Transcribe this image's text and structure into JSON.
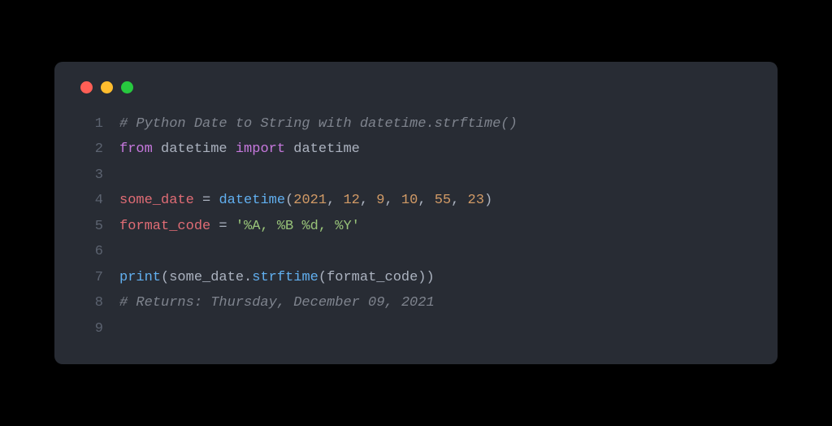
{
  "traffic_lights": {
    "red": "#ff5f56",
    "yellow": "#ffbd2e",
    "green": "#27c93f"
  },
  "line_numbers": [
    "1",
    "2",
    "3",
    "4",
    "5",
    "6",
    "7",
    "8",
    "9"
  ],
  "code": {
    "l1": {
      "comment": "# Python Date to String with datetime.strftime()"
    },
    "l2": {
      "kw_from": "from",
      "module1": "datetime",
      "kw_import": "import",
      "module2": "datetime"
    },
    "l4": {
      "var": "some_date",
      "eq": " = ",
      "func": "datetime",
      "open": "(",
      "n1": "2021",
      "c1": ", ",
      "n2": "12",
      "c2": ", ",
      "n3": "9",
      "c3": ", ",
      "n4": "10",
      "c4": ", ",
      "n5": "55",
      "c5": ", ",
      "n6": "23",
      "close": ")"
    },
    "l5": {
      "var": "format_code",
      "eq": " = ",
      "str": "'%A, %B %d, %Y'"
    },
    "l7": {
      "builtin": "print",
      "open1": "(",
      "arg1": "some_date",
      "dot": ".",
      "method": "strftime",
      "open2": "(",
      "arg2": "format_code",
      "close2": ")",
      "close1": ")"
    },
    "l8": {
      "comment": "# Returns: Thursday, December 09, 2021"
    }
  },
  "chart_data": {
    "type": "table",
    "title": "Python Date to String with datetime.strftime()",
    "language": "python",
    "source_lines": [
      "# Python Date to String with datetime.strftime()",
      "from datetime import datetime",
      "",
      "some_date = datetime(2021, 12, 9, 10, 55, 23)",
      "format_code = '%A, %B %d, %Y'",
      "",
      "print(some_date.strftime(format_code))",
      "# Returns: Thursday, December 09, 2021",
      ""
    ]
  }
}
